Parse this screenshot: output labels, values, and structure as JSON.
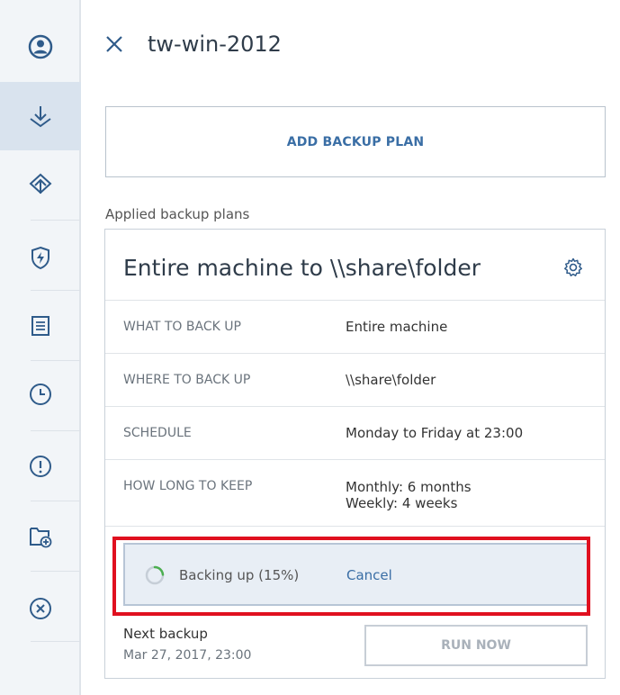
{
  "sidebar": {
    "items": [
      {
        "icon": "account-icon",
        "active": false
      },
      {
        "icon": "backup-icon",
        "active": true
      },
      {
        "icon": "recovery-icon",
        "active": false
      },
      {
        "icon": "shield-icon",
        "active": false
      },
      {
        "icon": "report-icon",
        "active": false
      },
      {
        "icon": "clock-icon",
        "active": false
      },
      {
        "icon": "alert-icon",
        "active": false
      },
      {
        "icon": "add-folder-icon",
        "active": false
      },
      {
        "icon": "close-circle-icon",
        "active": false
      }
    ]
  },
  "header": {
    "title": "tw-win-2012",
    "close_icon": "close-icon"
  },
  "add_plan": {
    "label": "ADD BACKUP PLAN"
  },
  "applied_label": "Applied backup plans",
  "plan": {
    "title": "Entire machine to \\\\share\\folder",
    "settings_icon": "gear-icon",
    "rows": [
      {
        "key": "WHAT TO BACK UP",
        "value": "Entire machine"
      },
      {
        "key": "WHERE TO BACK UP",
        "value": "\\\\share\\folder"
      },
      {
        "key": "SCHEDULE",
        "value": "Monday to Friday at 23:00"
      },
      {
        "key": "HOW LONG TO KEEP",
        "value": "Monthly: 6 months",
        "value2": "Weekly: 4 weeks"
      }
    ],
    "progress": {
      "text": "Backing up (15%)",
      "percent": 15,
      "cancel_label": "Cancel"
    },
    "next_backup": {
      "label": "Next backup",
      "value": "Mar 27, 2017, 23:00"
    },
    "run_now_label": "RUN NOW"
  },
  "colors": {
    "accent": "#3a6ea5",
    "highlight": "#e0101f",
    "icon": "#2f5b8a"
  }
}
